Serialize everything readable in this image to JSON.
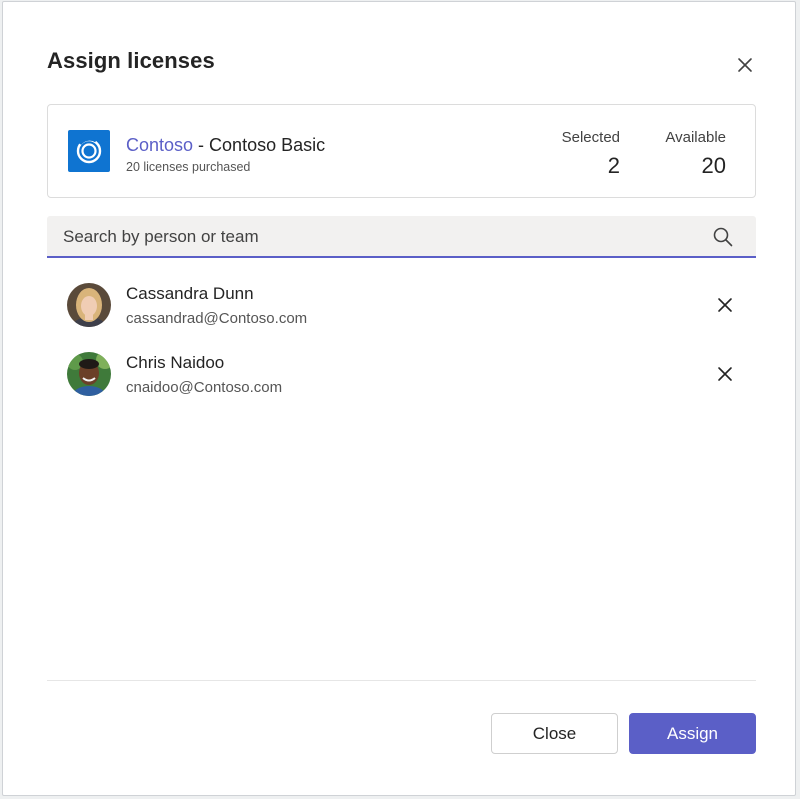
{
  "dialog": {
    "title": "Assign licenses"
  },
  "license": {
    "brand": "Contoso",
    "separator": " - ",
    "product": "Contoso Basic",
    "purchased": "20 licenses purchased",
    "selected_label": "Selected",
    "selected_value": "2",
    "available_label": "Available",
    "available_value": "20",
    "icon": "contoso-ring-icon"
  },
  "search": {
    "placeholder": "Search by person or team",
    "icon": "search-icon"
  },
  "people": [
    {
      "name": "Cassandra Dunn",
      "email": "cassandrad@Contoso.com",
      "avatar": "avatar-photo"
    },
    {
      "name": "Chris Naidoo",
      "email": "cnaidoo@Contoso.com",
      "avatar": "avatar-photo"
    }
  ],
  "footer": {
    "close_label": "Close",
    "assign_label": "Assign"
  },
  "colors": {
    "accent": "#5b5fc7",
    "app_icon": "#0f74d1"
  }
}
